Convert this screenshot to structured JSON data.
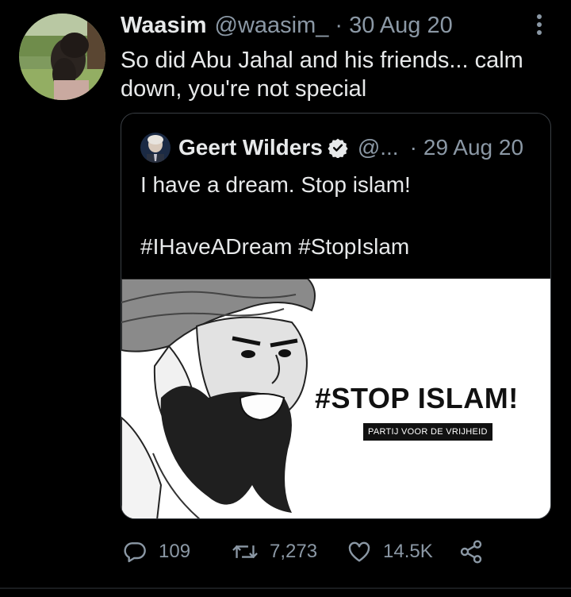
{
  "tweet": {
    "author_name": "Waasim",
    "author_handle": "@waasim_",
    "separator": "·",
    "date": "30 Aug 20",
    "text": "So did Abu Jahal and his friends... calm down, you're not special"
  },
  "quoted_tweet": {
    "author_name": "Geert Wilders",
    "author_handle": "@...",
    "separator": "·",
    "date": "29 Aug 20",
    "line1": "I have a dream. Stop islam!",
    "line2": "#IHaveADream #StopIslam",
    "image": {
      "slogan": "#STOP ISLAM!",
      "party_label": "PARTIJ VOOR DE VRIJHEID"
    }
  },
  "actions": {
    "reply_count": "109",
    "retweet_count": "7,273",
    "like_count": "14.5K"
  },
  "icons": [
    "more-icon",
    "verified-icon",
    "reply-icon",
    "retweet-icon",
    "like-icon",
    "share-icon"
  ],
  "colors": {
    "background": "#000000",
    "text_primary": "#e7e9ea",
    "text_secondary": "#8b98a5",
    "border": "#3a3f44"
  }
}
